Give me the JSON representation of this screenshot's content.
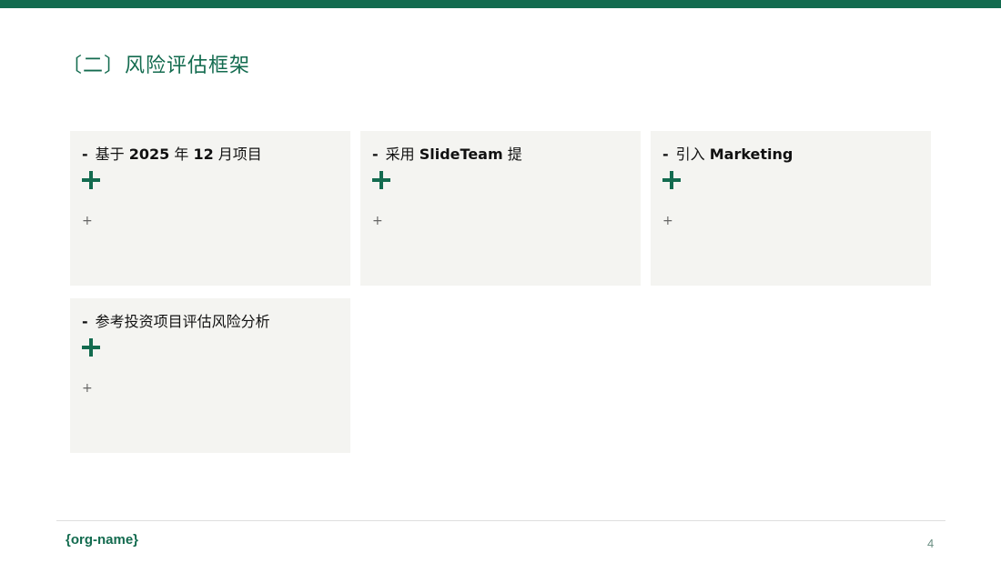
{
  "colors": {
    "accent": "#136b4f",
    "card_bg": "#f4f4f1",
    "text": "#111111"
  },
  "slide": {
    "title": "〔二〕风险评估框架",
    "cards": [
      {
        "dash": "-",
        "text": [
          "基于 ",
          "2025",
          " 年 ",
          "12",
          " 月项目"
        ],
        "big_icon": "plus-icon",
        "small_plus": "+"
      },
      {
        "dash": "-",
        "text": [
          "采用 ",
          "SlideTeam",
          " 提"
        ],
        "big_icon": "plus-icon",
        "small_plus": "+"
      },
      {
        "dash": "-",
        "text": [
          "引入 ",
          "Marketing"
        ],
        "big_icon": "plus-icon",
        "small_plus": "+"
      },
      {
        "dash": "-",
        "text": [
          "参考投资项目评估风险分析"
        ],
        "big_icon": "plus-icon",
        "small_plus": "+"
      }
    ]
  },
  "footer": {
    "org_name": "{org-name}",
    "page_number": "4"
  }
}
